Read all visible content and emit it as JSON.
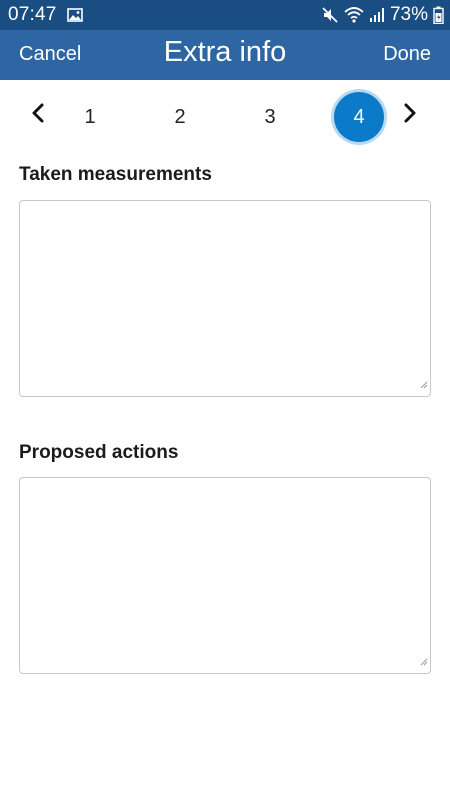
{
  "status_bar": {
    "time": "07:47",
    "battery_text": "73%",
    "icons": [
      "image-icon",
      "mute-icon",
      "wifi-icon",
      "signal-icon",
      "battery-icon"
    ]
  },
  "app_bar": {
    "cancel_label": "Cancel",
    "title": "Extra info",
    "done_label": "Done",
    "background": "#2e66a3"
  },
  "pager": {
    "pages": [
      "1",
      "2",
      "3",
      "4"
    ],
    "current_page": "4",
    "active_color": "#0a7ac9"
  },
  "form": {
    "measurements_label": "Taken measurements",
    "measurements_value": "",
    "actions_label": "Proposed actions",
    "actions_value": ""
  }
}
